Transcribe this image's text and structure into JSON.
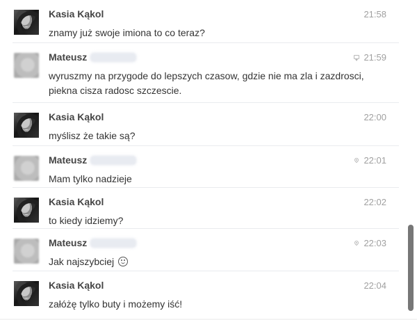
{
  "conversation": {
    "messages": [
      {
        "sender": "Kasia Kąkol",
        "time": "21:58",
        "text": "znamy już swoje imiona to co teraz?",
        "avatar": "kasia-avatar",
        "status_icon": ""
      },
      {
        "sender": "Mateusz",
        "time": "21:59",
        "text": "wyruszmy na przygode do lepszych czasow, gdzie nie ma zla i zazdrosci, piekna cisza radosc szczescie.",
        "avatar": "blurred-avatar",
        "status_icon": "chat-bubble-icon"
      },
      {
        "sender": "Kasia Kąkol",
        "time": "22:00",
        "text": "myślisz że takie są?",
        "avatar": "kasia-avatar",
        "status_icon": ""
      },
      {
        "sender": "Mateusz",
        "time": "22:01",
        "text": "Mam tylko nadzieje",
        "avatar": "blurred-avatar",
        "status_icon": "location-pin-icon"
      },
      {
        "sender": "Kasia Kąkol",
        "time": "22:02",
        "text": "to kiedy idziemy?",
        "avatar": "kasia-avatar",
        "status_icon": ""
      },
      {
        "sender": "Mateusz",
        "time": "22:03",
        "text": "Jak najszybciej",
        "emoji": "smile-emoji",
        "avatar": "blurred-avatar",
        "status_icon": "location-pin-icon"
      },
      {
        "sender": "Kasia Kąkol",
        "time": "22:04",
        "text": "załóżę tylko buty i możemy iść!",
        "avatar": "kasia-avatar",
        "status_icon": ""
      }
    ]
  },
  "colors": {
    "name": "#454545",
    "message": "#333333",
    "time": "#a0a0a0",
    "divider": "#e9ebee",
    "scrollbar_thumb": "#777777"
  }
}
